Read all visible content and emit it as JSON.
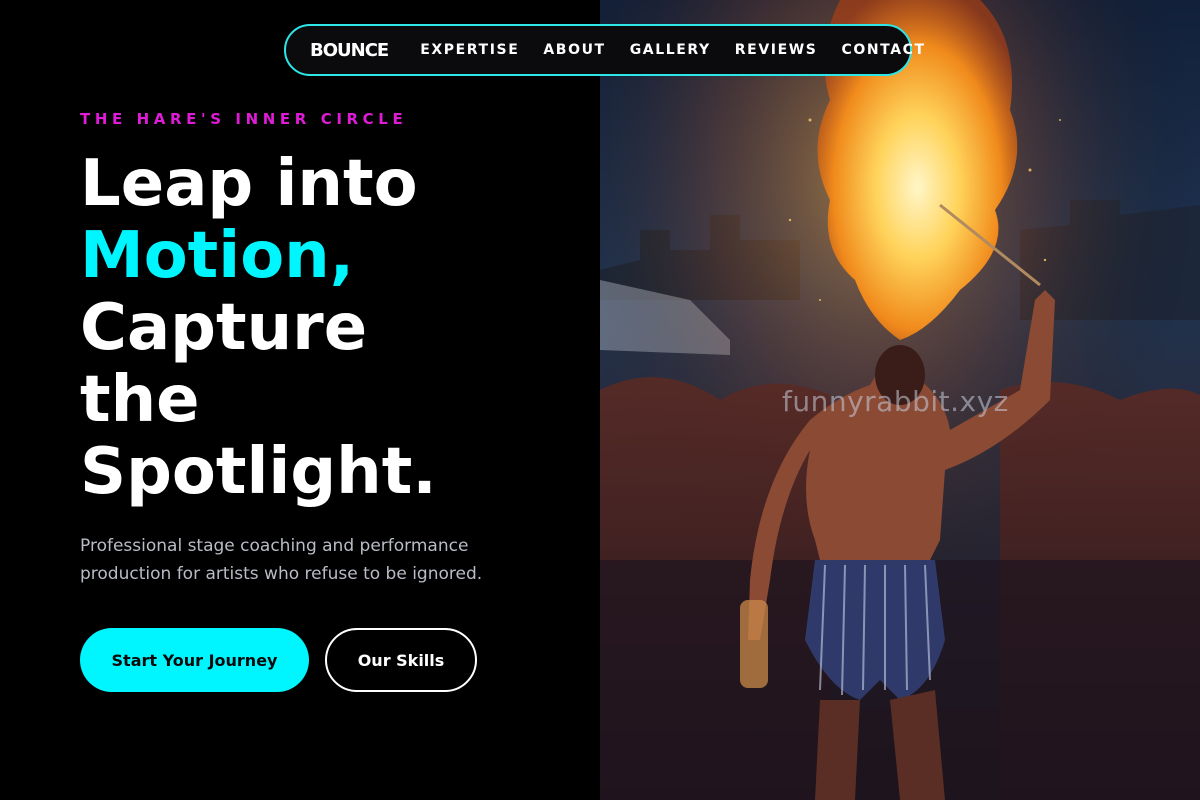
{
  "nav": {
    "logo": "BOUNCE",
    "links": [
      "EXPERTISE",
      "ABOUT",
      "GALLERY",
      "REVIEWS",
      "CONTACT"
    ]
  },
  "hero": {
    "eyebrow": "THE HARE'S INNER CIRCLE",
    "headline": {
      "line1": "Leap into",
      "line2_accent": "Motion,",
      "line3": "Capture",
      "line4": "the",
      "line5": "Spotlight."
    },
    "subtitle_line1": "Professional stage coaching and performance",
    "subtitle_line2": "production for artists who refuse to be ignored.",
    "primary_button": "Start Your Journey",
    "secondary_button": "Our Skills"
  },
  "image": {
    "watermark": "funnyrabbit.xyz"
  },
  "colors": {
    "accent_cyan": "#00f6ff",
    "accent_magenta": "#e01bd8",
    "nav_border": "#2ee6e6",
    "background": "#000000"
  }
}
